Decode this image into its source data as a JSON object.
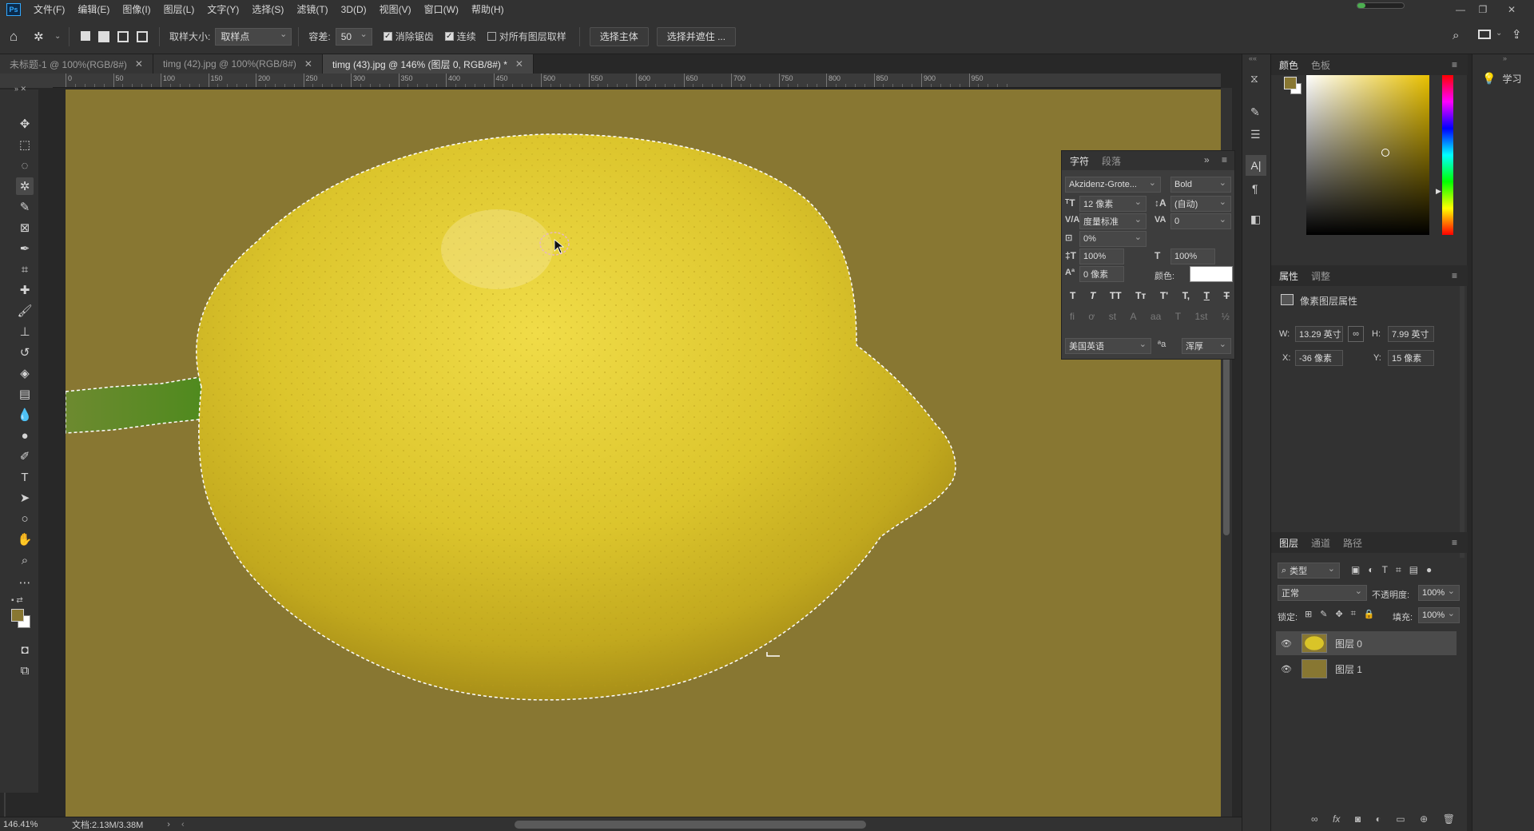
{
  "menubar": {
    "logo": "Ps",
    "items": [
      "文件(F)",
      "编辑(E)",
      "图像(I)",
      "图层(L)",
      "文字(Y)",
      "选择(S)",
      "滤镜(T)",
      "3D(D)",
      "视图(V)",
      "窗口(W)",
      "帮助(H)"
    ]
  },
  "options": {
    "sample_size_label": "取样大小:",
    "sample_size_value": "取样点",
    "tolerance_label": "容差:",
    "tolerance_value": "50",
    "antialias_label": "消除锯齿",
    "antialias_checked": true,
    "contiguous_label": "连续",
    "contiguous_checked": true,
    "all_layers_label": "对所有图层取样",
    "all_layers_checked": false,
    "select_subject": "选择主体",
    "select_mask": "选择并遮住 ..."
  },
  "tabs": [
    {
      "label": "未标题-1 @ 100%(RGB/8#)",
      "active": false
    },
    {
      "label": "timg (42).jpg @ 100%(RGB/8#)",
      "active": false
    },
    {
      "label": "timg (43).jpg @ 146% (图层 0, RGB/8#) *",
      "active": true
    }
  ],
  "ruler": {
    "ticks": [
      "0",
      "50",
      "100",
      "150",
      "200",
      "250",
      "300",
      "350",
      "400",
      "450",
      "500",
      "550",
      "600",
      "650",
      "700",
      "750",
      "800",
      "850",
      "900",
      "950"
    ]
  },
  "status": {
    "zoom": "146.41%",
    "doc": "文档:2.13M/3.38M"
  },
  "char_panel": {
    "tab_char": "字符",
    "tab_para": "段落",
    "font_family": "Akzidenz-Grote...",
    "font_style": "Bold",
    "size": "12 像素",
    "leading": "(自动)",
    "kerning": "度量标准",
    "tracking": "0",
    "tsume": "0%",
    "vscale": "100%",
    "hscale": "100%",
    "baseline": "0 像素",
    "color_label": "颜色:",
    "language": "美国英语",
    "aa_label": "ªa",
    "aa_mode": "浑厚",
    "type_buttons": [
      "T",
      "T",
      "TT",
      "Tт",
      "T'",
      "T,",
      "T",
      "T"
    ],
    "ot_buttons": [
      "ﬁ",
      "ơ",
      "st",
      "A",
      "aa",
      "T",
      "1st",
      "½"
    ]
  },
  "color_panel": {
    "tab_color": "颜色",
    "tab_swatches": "色板",
    "foreground": "#887732",
    "background": "#ffffff"
  },
  "properties_panel": {
    "tab_props": "属性",
    "tab_adjust": "调整",
    "title": "像素图层属性",
    "w_label": "W:",
    "w_value": "13.29 英寸",
    "h_label": "H:",
    "h_value": "7.99 英寸",
    "x_label": "X:",
    "x_value": "-36 像素",
    "y_label": "Y:",
    "y_value": "15 像素"
  },
  "layers_panel": {
    "tab_layers": "图层",
    "tab_channels": "通道",
    "tab_paths": "路径",
    "filter_kind": "类型",
    "blend_mode": "正常",
    "opacity_label": "不透明度:",
    "opacity_value": "100%",
    "lock_label": "锁定:",
    "fill_label": "填充:",
    "fill_value": "100%",
    "layers": [
      {
        "name": "图层 0",
        "selected": true,
        "thumb_color": "#d9c428"
      },
      {
        "name": "图层 1",
        "selected": false,
        "thumb_color": "#887732"
      }
    ],
    "footer_icons": [
      "link-icon",
      "fx-icon",
      "mask-icon",
      "adjustment-icon",
      "group-icon",
      "new-layer-icon",
      "trash-icon"
    ]
  },
  "learn": {
    "label": "学习"
  },
  "colors": {
    "canvas_bg": "#887732",
    "lemon": "#d8c22c",
    "accent": "#31a8ff"
  }
}
